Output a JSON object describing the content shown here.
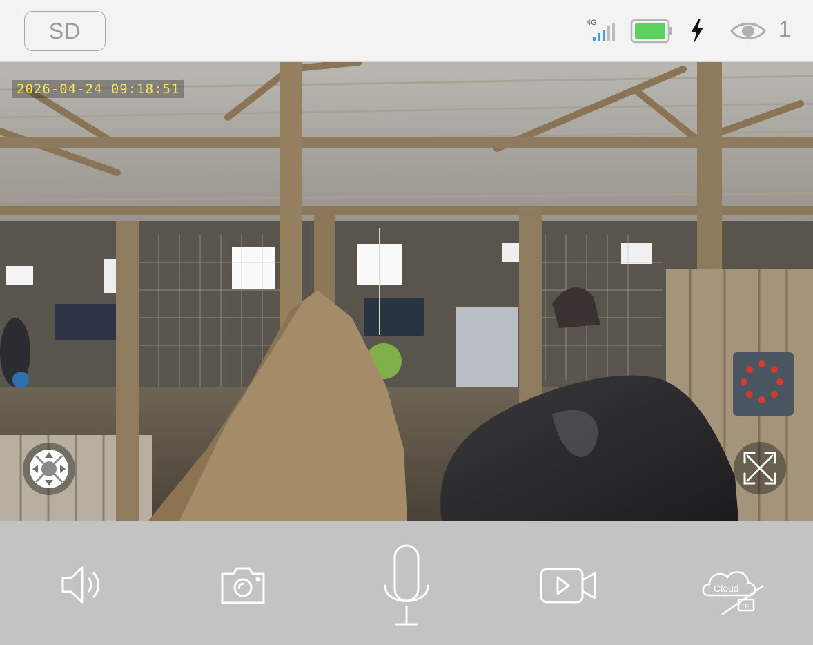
{
  "header": {
    "storage_label": "SD",
    "network_type": "4G",
    "signal_icon": "cellular-signal-icon",
    "battery_icon": "battery-icon",
    "battery_level": 1.0,
    "charging_icon": "charging-bolt-icon",
    "viewers_icon": "eye-icon",
    "viewer_count": "1"
  },
  "video": {
    "timestamp": "2026-04-24 09:18:51",
    "ptz_icon": "ptz-joystick-icon",
    "fullscreen_icon": "fullscreen-expand-icon"
  },
  "toolbar": {
    "speaker_icon": "speaker-icon",
    "snapshot_icon": "camera-icon",
    "talk_icon": "microphone-icon",
    "record_icon": "video-record-icon",
    "cloud_label": "Cloud",
    "tf_label": "TF"
  },
  "colors": {
    "topbar_bg": "#f3f3f3",
    "bottombar_bg": "#c3c3c3",
    "battery_green": "#5fd15f",
    "signal_blue": "#4a9ee3",
    "timestamp_yellow": "#f5e45a"
  }
}
